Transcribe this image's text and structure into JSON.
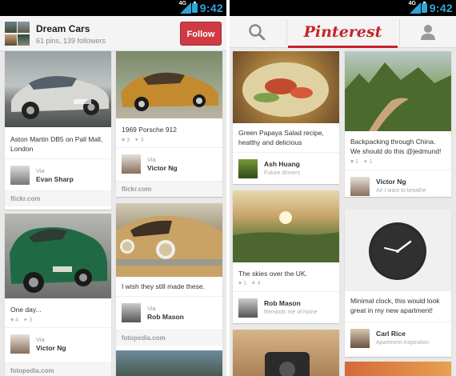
{
  "status_bar": {
    "time": "9:42",
    "network": "4G"
  },
  "board": {
    "title": "Dream Cars",
    "meta": "61 pins, 139 followers",
    "follow_label": "Follow"
  },
  "app_bar": {
    "logo": "Pinterest",
    "search_icon": "search-icon",
    "profile_icon": "person-icon"
  },
  "left_pins": [
    {
      "desc": "Aston Martin DB5 on Pall Mall, London",
      "via": "Via",
      "name": "Evan Sharp",
      "source": "flickr.com"
    },
    {
      "desc": "1969 Porsche 912",
      "repins": "3",
      "likes": "3",
      "via": "Via",
      "name": "Victor Ng",
      "source": "flickr.com"
    },
    {
      "desc": "One day...",
      "repins": "4",
      "likes": "3",
      "via": "Via",
      "name": "Victor Ng",
      "source": "fotopedia.com"
    },
    {
      "desc": "I wish they still made these.",
      "via": "Via",
      "name": "Rob Mason",
      "source": "fotopedia.com"
    }
  ],
  "right_pins": [
    {
      "desc": "Green Papaya Salad recipe, healthy and delicious",
      "name": "Ash Huang",
      "board": "Future dinners"
    },
    {
      "desc": "Backpacking through China. We should do this @jedmund!",
      "repins": "1",
      "likes": "1",
      "name": "Victor Ng",
      "board": "Air I want to breathe"
    },
    {
      "desc": "The skies over the UK.",
      "repins": "1",
      "likes": "4",
      "name": "Rob Mason",
      "board": "Reminds me of home"
    },
    {
      "desc": "Minimal clock, this would look great in my new apartment!",
      "name": "Carl Rice",
      "board": "Apartment inspiration"
    }
  ],
  "colors": {
    "accent": "#cf3b44",
    "logo": "#c8232c"
  }
}
